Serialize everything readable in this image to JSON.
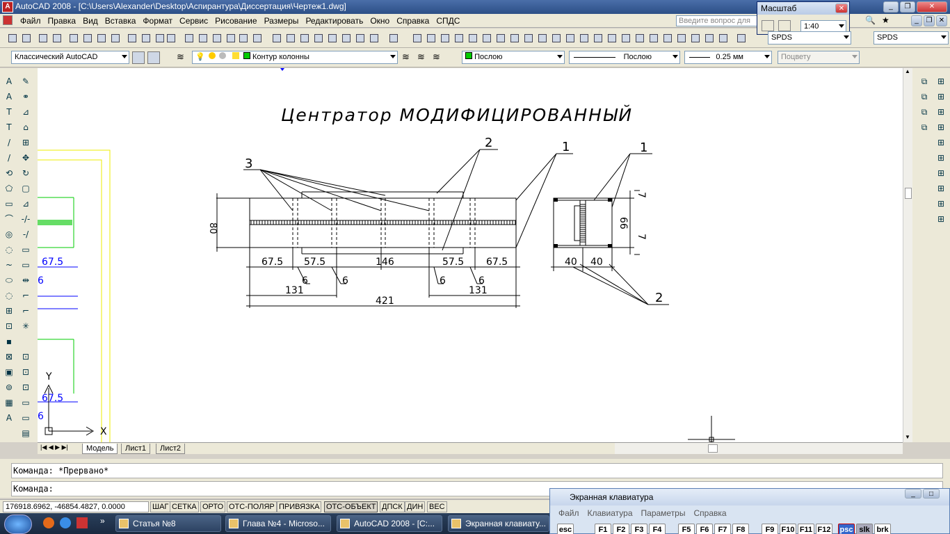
{
  "window": {
    "title": "AutoCAD 2008 - [C:\\Users\\Alexander\\Desktop\\Аспирантура\\Диссертация\\Чертеж1.dwg]",
    "app_icon": "A"
  },
  "menu": [
    "Файл",
    "Правка",
    "Вид",
    "Вставка",
    "Формат",
    "Сервис",
    "Рисование",
    "Размеры",
    "Редактировать",
    "Окно",
    "Справка",
    "СПДС"
  ],
  "help_search": {
    "placeholder": "Введите вопрос для"
  },
  "scale_window": {
    "title": "Масштаб",
    "value": "1:40"
  },
  "toolbar_right": {
    "style1": "SPDS",
    "style2": "SPDS"
  },
  "workspace": {
    "value": "Классический AutoCAD"
  },
  "layer": {
    "value": "Контур колонны"
  },
  "properties": {
    "color": "Послою",
    "linetype": "Послою",
    "lineweight": "0.25 мм",
    "plotstyle": "Поцвету"
  },
  "drawing": {
    "title": "Центратор МОДИФИЦИРОВАННЫЙ",
    "leader_labels": [
      "3",
      "2",
      "1",
      "1",
      "2"
    ],
    "dims_bottom": [
      "67.5",
      "57.5",
      "146",
      "57.5",
      "67.5"
    ],
    "dims_small": [
      "6",
      "6",
      "6",
      "6"
    ],
    "dims_131": [
      "131",
      "131"
    ],
    "dim_total": "421",
    "dim_height": "80",
    "side_dims": [
      "40",
      "40"
    ],
    "side_vert": [
      "7",
      "66",
      "7"
    ],
    "left_partial": [
      "67.5",
      "6",
      "67.5",
      "6"
    ],
    "ucs": {
      "x": "X",
      "y": "Y"
    }
  },
  "tabs": [
    "Модель",
    "Лист1",
    "Лист2"
  ],
  "command": {
    "line1": "Команда: *Прервано*",
    "line2": "Команда:"
  },
  "status": {
    "coords": "176918.6962, -46854.4827, 0.0000",
    "buttons": [
      "ШАГ",
      "СЕТКА",
      "ОРТО",
      "ОТС-ПОЛЯР",
      "ПРИВЯЗКА",
      "ОТС-ОБЪЕКТ",
      "ДПСК",
      "ДИН",
      "ВЕС"
    ]
  },
  "osk": {
    "title": "Экранная клавиатура",
    "menu": [
      "Файл",
      "Клавиатура",
      "Параметры",
      "Справка"
    ],
    "keys": [
      "esc",
      "F1",
      "F2",
      "F3",
      "F4",
      "F5",
      "F6",
      "F7",
      "F8",
      "F9",
      "F10",
      "F11",
      "F12",
      "psc",
      "slk",
      "brk"
    ]
  },
  "taskbar": {
    "tasks": [
      "Статья №8",
      "Глава №4 - Microso...",
      "AutoCAD 2008 - [C:...",
      "Экранная клавиату..."
    ]
  },
  "colors": {
    "accent": "#0000ff",
    "green": "#00cc00",
    "yellow": "#ffff00"
  }
}
